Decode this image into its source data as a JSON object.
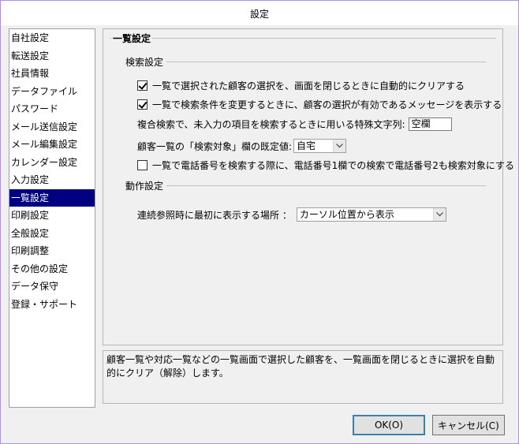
{
  "window": {
    "title": "設定"
  },
  "sidebar": {
    "items": [
      "自社設定",
      "転送設定",
      "社員情報",
      "データファイル",
      "パスワード",
      "メール送信設定",
      "メール編集設定",
      "カレンダー設定",
      "入力設定",
      "一覧設定",
      "印刷設定",
      "全般設定",
      "印刷調整",
      "その他の設定",
      "データ保守",
      "登録・サポート"
    ],
    "active_index": 9
  },
  "panel": {
    "title": "一覧設定",
    "search_section": {
      "title": "検索設定",
      "clear_on_close": {
        "label": "一覧で選択された顧客の選択を、画面を閉じるときに自動的にクリアする",
        "checked": true
      },
      "show_message": {
        "label": "一覧で検索条件を変更するときに、顧客の選択が有効であるメッセージを表示する",
        "checked": true
      },
      "special_char": {
        "label": "複合検索で、未入力の項目を検索するときに用いる特殊文字列:",
        "value": "空欄"
      },
      "default_target": {
        "label": "顧客一覧の「検索対象」欄の既定値:",
        "value": "自宅"
      },
      "phone_search": {
        "label": "一覧で電話番号を検索する際に、電話番号1欄での検索で電話番号2も検索対象にする",
        "checked": false
      }
    },
    "action_section": {
      "title": "動作設定",
      "first_display": {
        "label": "連続参照時に最初に表示する場所 ：",
        "value": "カーソル位置から表示"
      }
    }
  },
  "description": "顧客一覧や対応一覧などの一覧画面で選択した顧客を、一覧画面を閉じるときに選択を自動的にクリア（解除）します。",
  "buttons": {
    "ok": "OK(O)",
    "cancel": "キャンセル(C)"
  }
}
